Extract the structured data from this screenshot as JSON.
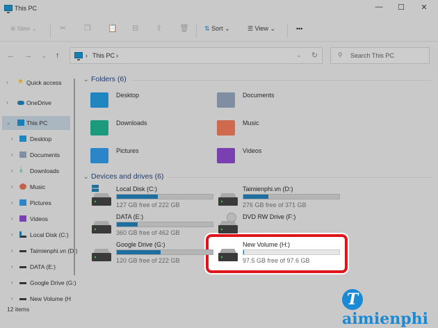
{
  "window": {
    "title": "This PC",
    "minimize": "—",
    "maximize": "☐",
    "close": "✕"
  },
  "toolbar": {
    "new_label": "New",
    "sort_label": "Sort",
    "view_label": "View",
    "more": "•••"
  },
  "address": {
    "crumb": "This PC",
    "sep": "›",
    "search_placeholder": "Search This PC"
  },
  "sidebar": {
    "items": [
      {
        "label": "Quick access"
      },
      {
        "label": "OneDrive"
      },
      {
        "label": "This PC"
      },
      {
        "label": "Desktop"
      },
      {
        "label": "Documents"
      },
      {
        "label": "Downloads"
      },
      {
        "label": "Music"
      },
      {
        "label": "Pictures"
      },
      {
        "label": "Videos"
      },
      {
        "label": "Local Disk (C:)"
      },
      {
        "label": "Taimienphi.vn (D:)"
      },
      {
        "label": "DATA (E:)"
      },
      {
        "label": "Google Drive (G:)"
      },
      {
        "label": "New Volume (H:)"
      }
    ]
  },
  "folders": {
    "header": "Folders (6)",
    "items": [
      {
        "label": "Desktop",
        "color": "#1f86c0"
      },
      {
        "label": "Documents",
        "color": "#7f8ea0"
      },
      {
        "label": "Downloads",
        "color": "#1c9a7c"
      },
      {
        "label": "Music",
        "color": "#d06a4f"
      },
      {
        "label": "Pictures",
        "color": "#2a86c8"
      },
      {
        "label": "Videos",
        "color": "#7a3fb0"
      }
    ]
  },
  "drives": {
    "header": "Devices and drives (6)",
    "items": [
      {
        "name": "Local Disk (C:)",
        "free": "127 GB free of 222 GB",
        "used": 0.43
      },
      {
        "name": "Taimienphi.vn (D:)",
        "free": "276 GB free of 371 GB",
        "used": 0.26
      },
      {
        "name": "DATA (E:)",
        "free": "360 GB free of 462 GB",
        "used": 0.22
      },
      {
        "name": "DVD RW Drive (F:)"
      },
      {
        "name": "Google Drive (G:)",
        "free": "120 GB free of 222 GB",
        "used": 0.46
      },
      {
        "name": "New Volume (H:)",
        "free": "97.5 GB free of 97.6 GB",
        "used": 0.001
      }
    ]
  },
  "status": {
    "items": "12 items"
  },
  "logo": {
    "text": "aimienphi",
    "initial": "T"
  }
}
